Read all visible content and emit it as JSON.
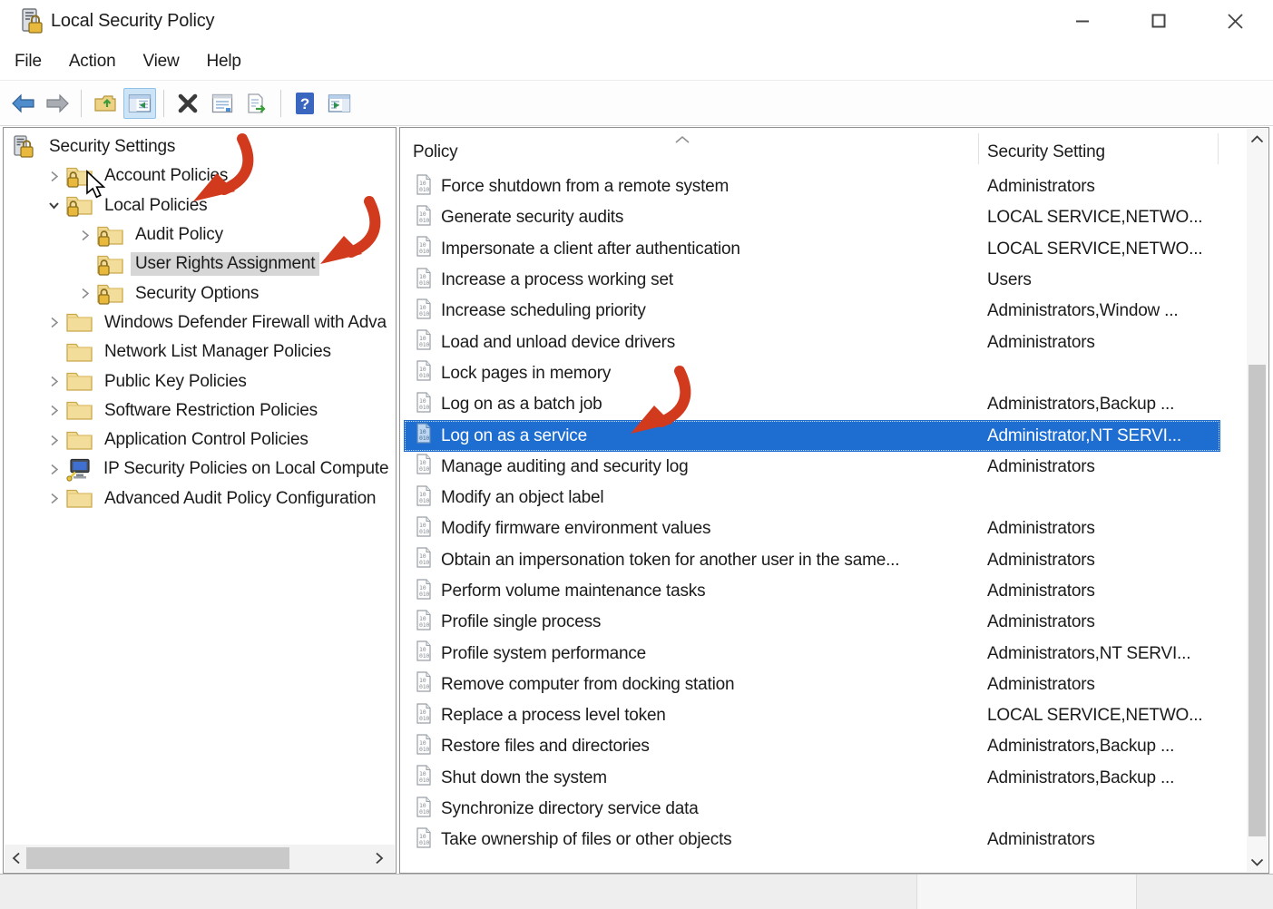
{
  "window": {
    "title": "Local Security Policy"
  },
  "title_controls": {
    "minimize": "minimize",
    "maximize": "maximize",
    "close": "close"
  },
  "menu": {
    "items": [
      "File",
      "Action",
      "View",
      "Help"
    ]
  },
  "toolbar": {
    "buttons": [
      {
        "name": "back",
        "icon": "back",
        "group": 1,
        "active": false
      },
      {
        "name": "forward",
        "icon": "forward",
        "group": 1,
        "active": false
      },
      {
        "name": "up-one-level",
        "icon": "up",
        "group": 2,
        "active": false
      },
      {
        "name": "show-hide-console-tree",
        "icon": "treepane",
        "group": 2,
        "active": true
      },
      {
        "name": "delete",
        "icon": "delete",
        "group": 3,
        "active": false
      },
      {
        "name": "properties",
        "icon": "props",
        "group": 3,
        "active": false
      },
      {
        "name": "export-list",
        "icon": "export",
        "group": 3,
        "active": false
      },
      {
        "name": "help",
        "icon": "help",
        "group": 4,
        "active": false
      },
      {
        "name": "show-hide-action-pane",
        "icon": "actionpane",
        "group": 4,
        "active": false
      }
    ]
  },
  "tree": {
    "items": [
      {
        "label": "Security Settings",
        "level": 0,
        "icon": "security-root",
        "expander": "none",
        "selected": false
      },
      {
        "label": "Account Policies",
        "level": 1,
        "icon": "folder-lock",
        "expander": "collapsed",
        "selected": false
      },
      {
        "label": "Local Policies",
        "level": 1,
        "icon": "folder-lock",
        "expander": "expanded",
        "selected": false
      },
      {
        "label": "Audit Policy",
        "level": 2,
        "icon": "folder-lock",
        "expander": "collapsed",
        "selected": false
      },
      {
        "label": "User Rights Assignment",
        "level": 2,
        "icon": "folder-lock",
        "expander": "blank",
        "selected": true
      },
      {
        "label": "Security Options",
        "level": 2,
        "icon": "folder-lock",
        "expander": "collapsed",
        "selected": false
      },
      {
        "label": "Windows Defender Firewall with Adva",
        "level": 1,
        "icon": "folder",
        "expander": "collapsed",
        "selected": false
      },
      {
        "label": "Network List Manager Policies",
        "level": 1,
        "icon": "folder",
        "expander": "blank",
        "selected": false
      },
      {
        "label": "Public Key Policies",
        "level": 1,
        "icon": "folder",
        "expander": "collapsed",
        "selected": false
      },
      {
        "label": "Software Restriction Policies",
        "level": 1,
        "icon": "folder",
        "expander": "collapsed",
        "selected": false
      },
      {
        "label": "Application Control Policies",
        "level": 1,
        "icon": "folder",
        "expander": "collapsed",
        "selected": false
      },
      {
        "label": "IP Security Policies on Local Compute",
        "level": 1,
        "icon": "ipsec",
        "expander": "collapsed",
        "selected": false
      },
      {
        "label": "Advanced Audit Policy Configuration",
        "level": 1,
        "icon": "folder",
        "expander": "collapsed",
        "selected": false
      }
    ]
  },
  "list": {
    "columns": [
      "Policy",
      "Security Setting"
    ],
    "selected_index": 8,
    "rows": [
      {
        "policy": "Force shutdown from a remote system",
        "setting": "Administrators"
      },
      {
        "policy": "Generate security audits",
        "setting": "LOCAL SERVICE,NETWO..."
      },
      {
        "policy": "Impersonate a client after authentication",
        "setting": "LOCAL SERVICE,NETWO..."
      },
      {
        "policy": "Increase a process working set",
        "setting": "Users"
      },
      {
        "policy": "Increase scheduling priority",
        "setting": "Administrators,Window ..."
      },
      {
        "policy": "Load and unload device drivers",
        "setting": "Administrators"
      },
      {
        "policy": "Lock pages in memory",
        "setting": ""
      },
      {
        "policy": "Log on as a batch job",
        "setting": "Administrators,Backup ..."
      },
      {
        "policy": "Log on as a service",
        "setting": "Administrator,NT SERVI..."
      },
      {
        "policy": "Manage auditing and security log",
        "setting": "Administrators"
      },
      {
        "policy": "Modify an object label",
        "setting": ""
      },
      {
        "policy": "Modify firmware environment values",
        "setting": "Administrators"
      },
      {
        "policy": "Obtain an impersonation token for another user in the same...",
        "setting": "Administrators"
      },
      {
        "policy": "Perform volume maintenance tasks",
        "setting": "Administrators"
      },
      {
        "policy": "Profile single process",
        "setting": "Administrators"
      },
      {
        "policy": "Profile system performance",
        "setting": "Administrators,NT SERVI..."
      },
      {
        "policy": "Remove computer from docking station",
        "setting": "Administrators"
      },
      {
        "policy": "Replace a process level token",
        "setting": "LOCAL SERVICE,NETWO..."
      },
      {
        "policy": "Restore files and directories",
        "setting": "Administrators,Backup ..."
      },
      {
        "policy": "Shut down the system",
        "setting": "Administrators,Backup ..."
      },
      {
        "policy": "Synchronize directory service data",
        "setting": ""
      },
      {
        "policy": "Take ownership of files or other objects",
        "setting": "Administrators"
      }
    ]
  },
  "colors": {
    "selection_blue": "#1e6ed2",
    "annotation_arrow_red": "#d23a1e",
    "tree_selection_gray": "#d6d6d6"
  },
  "annotations": {
    "arrows": [
      {
        "points_at": "Local Policies"
      },
      {
        "points_at": "User Rights Assignment"
      },
      {
        "points_at": "Log on as a service"
      }
    ],
    "cursor": {
      "near": "Account Policies"
    }
  }
}
